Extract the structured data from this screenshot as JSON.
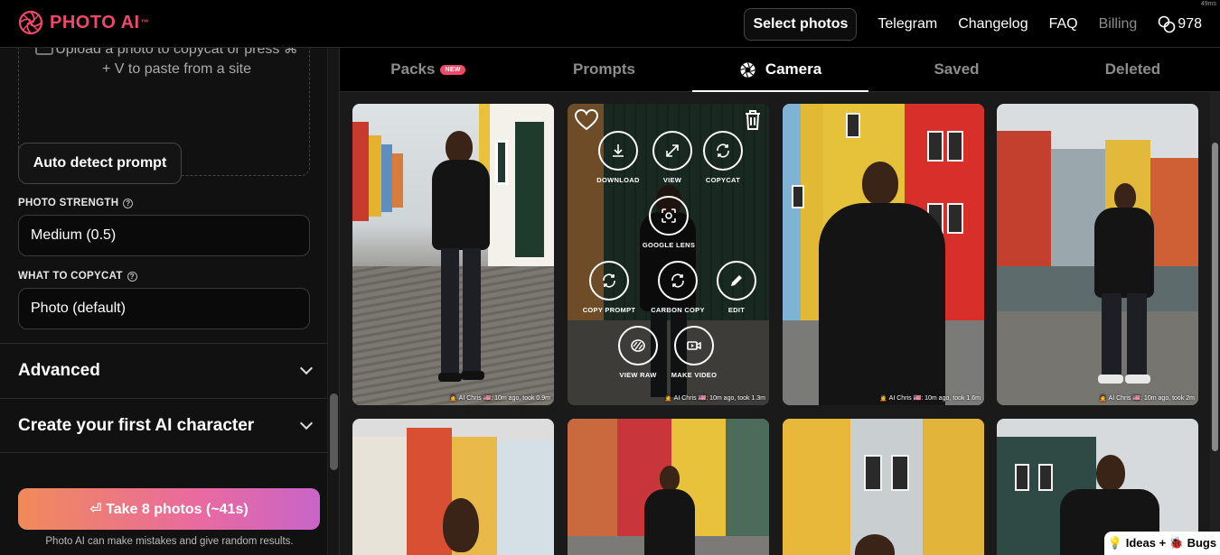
{
  "brand": {
    "name": "PHOTO AI",
    "tm": "™",
    "accent": "#f04868"
  },
  "latency": "49ms",
  "nav": {
    "select_photos": "Select photos",
    "links": [
      "Telegram",
      "Changelog",
      "FAQ",
      "Billing"
    ],
    "credits": "978"
  },
  "left": {
    "upload_text": "Upload a photo to copycat or press ⌘ + V to paste from a site",
    "auto_detect": "Auto detect prompt",
    "photo_strength_label": "PHOTO STRENGTH",
    "photo_strength_value": "Medium (0.5)",
    "copycat_label": "WHAT TO COPYCAT",
    "copycat_value": "Photo (default)",
    "accordions": [
      "Advanced",
      "Create your first AI character"
    ],
    "take_button": "⏎ Take 8 photos (~41s)",
    "disclaimer": "Photo AI can make mistakes and give random results."
  },
  "tabs": {
    "items": [
      "Packs",
      "Prompts",
      "Camera",
      "Saved",
      "Deleted"
    ],
    "new_badge": "NEW",
    "active": "Camera"
  },
  "overlay_actions": {
    "download": "DOWNLOAD",
    "view": "VIEW",
    "copycat": "COPYCAT",
    "google_lens": "GOOGLE LENS",
    "copy_prompt": "COPY PROMPT",
    "carbon_copy": "CARBON COPY",
    "edit": "EDIT",
    "view_raw": "VIEW RAW",
    "make_video": "MAKE VIDEO"
  },
  "photos": [
    {
      "caption": "🙍 AI Chris 🇺🇸: 10m ago, took 0.9m"
    },
    {
      "caption": "🙍 AI Chris 🇺🇸: 10m ago, took 1.3m"
    },
    {
      "caption": "🙍 AI Chris 🇺🇸: 10m ago, took 1.6m"
    },
    {
      "caption": "🙍 AI Chris 🇺🇸: 10m ago, took 2m"
    }
  ],
  "ideas_button": "💡 Ideas + 🐞 Bugs"
}
